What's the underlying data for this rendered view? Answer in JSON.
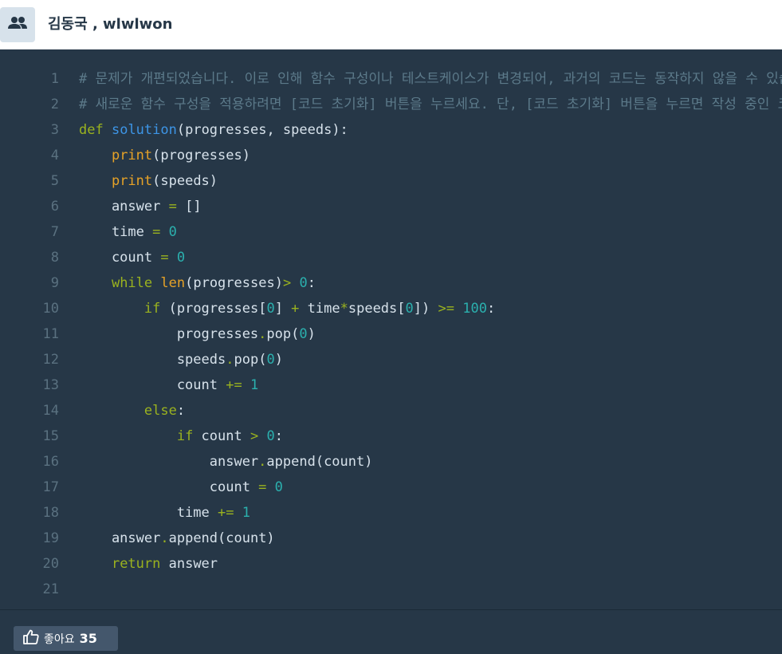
{
  "header": {
    "icon": "people-icon",
    "authors": "김동국 , wlwlwon"
  },
  "code": {
    "lines": [
      {
        "n": "1",
        "tokens": [
          {
            "t": "c",
            "v": "# 문제가 개편되었습니다. 이로 인해 함수 구성이나 테스트케이스가 변경되어, 과거의 코드는 동작하지 않을 수 있습니다."
          }
        ]
      },
      {
        "n": "2",
        "tokens": [
          {
            "t": "c",
            "v": "# 새로운 함수 구성을 적용하려면 [코드 초기화] 버튼을 누르세요. 단, [코드 초기화] 버튼을 누르면 작성 중인 코드는 사라집니다."
          }
        ]
      },
      {
        "n": "3",
        "tokens": [
          {
            "t": "k",
            "v": "def"
          },
          {
            "t": "p",
            "v": " "
          },
          {
            "t": "f",
            "v": "solution"
          },
          {
            "t": "p",
            "v": "(progresses, speeds):"
          }
        ]
      },
      {
        "n": "4",
        "tokens": [
          {
            "t": "p",
            "v": "    "
          },
          {
            "t": "b",
            "v": "print"
          },
          {
            "t": "p",
            "v": "(progresses)"
          }
        ]
      },
      {
        "n": "5",
        "tokens": [
          {
            "t": "p",
            "v": "    "
          },
          {
            "t": "b",
            "v": "print"
          },
          {
            "t": "p",
            "v": "(speeds)"
          }
        ]
      },
      {
        "n": "6",
        "tokens": [
          {
            "t": "p",
            "v": "    answer "
          },
          {
            "t": "o",
            "v": "="
          },
          {
            "t": "p",
            "v": " []"
          }
        ]
      },
      {
        "n": "7",
        "tokens": [
          {
            "t": "p",
            "v": "    time "
          },
          {
            "t": "o",
            "v": "="
          },
          {
            "t": "p",
            "v": " "
          },
          {
            "t": "n",
            "v": "0"
          }
        ]
      },
      {
        "n": "8",
        "tokens": [
          {
            "t": "p",
            "v": "    count "
          },
          {
            "t": "o",
            "v": "="
          },
          {
            "t": "p",
            "v": " "
          },
          {
            "t": "n",
            "v": "0"
          }
        ]
      },
      {
        "n": "9",
        "tokens": [
          {
            "t": "p",
            "v": "    "
          },
          {
            "t": "k",
            "v": "while"
          },
          {
            "t": "p",
            "v": " "
          },
          {
            "t": "b",
            "v": "len"
          },
          {
            "t": "p",
            "v": "(progresses)"
          },
          {
            "t": "o",
            "v": ">"
          },
          {
            "t": "p",
            "v": " "
          },
          {
            "t": "n",
            "v": "0"
          },
          {
            "t": "p",
            "v": ":"
          }
        ]
      },
      {
        "n": "10",
        "tokens": [
          {
            "t": "p",
            "v": "        "
          },
          {
            "t": "k",
            "v": "if"
          },
          {
            "t": "p",
            "v": " (progresses["
          },
          {
            "t": "n",
            "v": "0"
          },
          {
            "t": "p",
            "v": "] "
          },
          {
            "t": "o",
            "v": "+"
          },
          {
            "t": "p",
            "v": " time"
          },
          {
            "t": "o",
            "v": "*"
          },
          {
            "t": "p",
            "v": "speeds["
          },
          {
            "t": "n",
            "v": "0"
          },
          {
            "t": "p",
            "v": "]) "
          },
          {
            "t": "o",
            "v": ">="
          },
          {
            "t": "p",
            "v": " "
          },
          {
            "t": "n",
            "v": "100"
          },
          {
            "t": "p",
            "v": ":"
          }
        ]
      },
      {
        "n": "11",
        "tokens": [
          {
            "t": "p",
            "v": "            progresses"
          },
          {
            "t": "o",
            "v": "."
          },
          {
            "t": "p",
            "v": "pop("
          },
          {
            "t": "n",
            "v": "0"
          },
          {
            "t": "p",
            "v": ")"
          }
        ]
      },
      {
        "n": "12",
        "tokens": [
          {
            "t": "p",
            "v": "            speeds"
          },
          {
            "t": "o",
            "v": "."
          },
          {
            "t": "p",
            "v": "pop("
          },
          {
            "t": "n",
            "v": "0"
          },
          {
            "t": "p",
            "v": ")"
          }
        ]
      },
      {
        "n": "13",
        "tokens": [
          {
            "t": "p",
            "v": "            count "
          },
          {
            "t": "o",
            "v": "+="
          },
          {
            "t": "p",
            "v": " "
          },
          {
            "t": "n",
            "v": "1"
          }
        ]
      },
      {
        "n": "14",
        "tokens": [
          {
            "t": "p",
            "v": "        "
          },
          {
            "t": "k",
            "v": "else"
          },
          {
            "t": "p",
            "v": ":"
          }
        ]
      },
      {
        "n": "15",
        "tokens": [
          {
            "t": "p",
            "v": "            "
          },
          {
            "t": "k",
            "v": "if"
          },
          {
            "t": "p",
            "v": " count "
          },
          {
            "t": "o",
            "v": ">"
          },
          {
            "t": "p",
            "v": " "
          },
          {
            "t": "n",
            "v": "0"
          },
          {
            "t": "p",
            "v": ":"
          }
        ]
      },
      {
        "n": "16",
        "tokens": [
          {
            "t": "p",
            "v": "                answer"
          },
          {
            "t": "o",
            "v": "."
          },
          {
            "t": "p",
            "v": "append(count)"
          }
        ]
      },
      {
        "n": "17",
        "tokens": [
          {
            "t": "p",
            "v": "                count "
          },
          {
            "t": "o",
            "v": "="
          },
          {
            "t": "p",
            "v": " "
          },
          {
            "t": "n",
            "v": "0"
          }
        ]
      },
      {
        "n": "18",
        "tokens": [
          {
            "t": "p",
            "v": "            time "
          },
          {
            "t": "o",
            "v": "+="
          },
          {
            "t": "p",
            "v": " "
          },
          {
            "t": "n",
            "v": "1"
          }
        ]
      },
      {
        "n": "19",
        "tokens": [
          {
            "t": "p",
            "v": "    answer"
          },
          {
            "t": "o",
            "v": "."
          },
          {
            "t": "p",
            "v": "append(count)"
          }
        ]
      },
      {
        "n": "20",
        "tokens": [
          {
            "t": "p",
            "v": "    "
          },
          {
            "t": "k",
            "v": "return"
          },
          {
            "t": "p",
            "v": " answer"
          }
        ]
      },
      {
        "n": "21",
        "tokens": []
      }
    ]
  },
  "footer": {
    "like_icon": "thumbs-up-icon",
    "like_label": "좋아요",
    "like_count": "35"
  },
  "colors": {
    "code_bg": "#263747",
    "comment": "#5c7a8a",
    "keyword": "#9ab21f",
    "function": "#3d95e6",
    "builtin": "#e6a227",
    "number": "#2bb0ae",
    "like_button_bg": "#44576c"
  }
}
